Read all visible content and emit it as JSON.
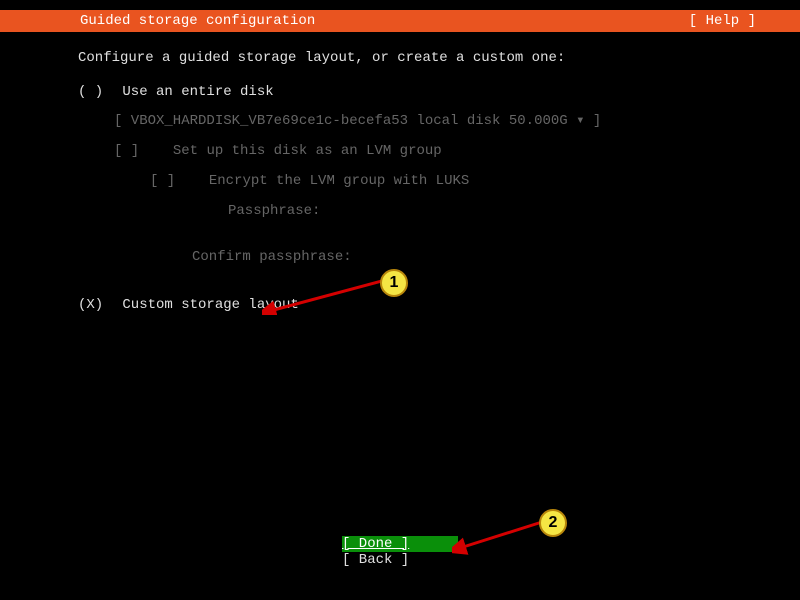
{
  "header": {
    "title": "Guided storage configuration",
    "help": "[ Help ]"
  },
  "instruction": "Configure a guided storage layout, or create a custom one:",
  "options": {
    "entire_disk": {
      "radio": "( )",
      "label": "Use an entire disk"
    },
    "disk_select": "[ VBOX_HARDDISK_VB7e69ce1c-becefa53 local disk 50.000G ▾ ]",
    "lvm": {
      "check": "[ ]",
      "label": "Set up this disk as an LVM group"
    },
    "encrypt": {
      "check": "[ ]",
      "label": "Encrypt the LVM group with LUKS"
    },
    "passphrase_label": "Passphrase:",
    "confirm_passphrase_label": "Confirm passphrase:",
    "custom": {
      "radio": "(X)",
      "label": "Custom storage layout"
    }
  },
  "footer": {
    "done": "[ Done       ]",
    "back": "[ Back       ]"
  },
  "annotations": {
    "badge1": "1",
    "badge2": "2"
  }
}
